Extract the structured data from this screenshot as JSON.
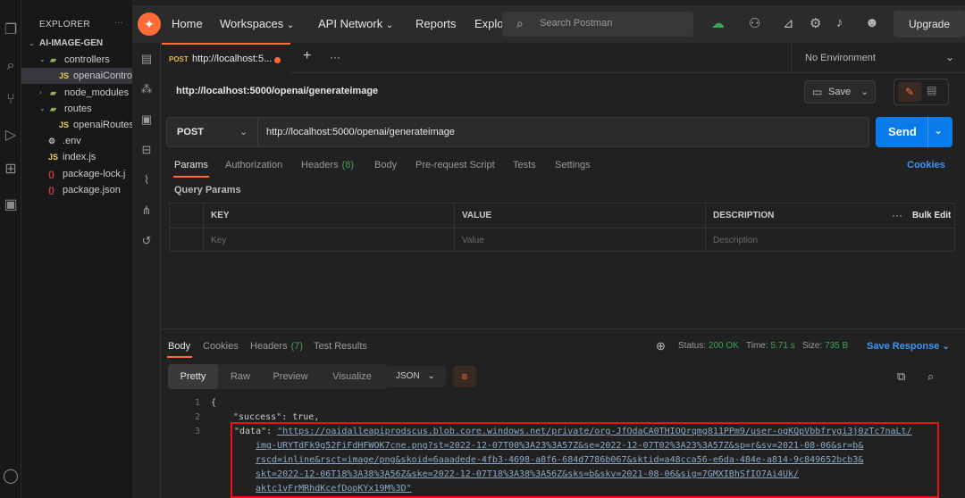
{
  "vscode": {
    "explorer_title": "EXPLORER",
    "explorer_more": "···",
    "tree": [
      {
        "label": "AI-IMAGE-GEN",
        "depth": 0,
        "kind": "root"
      },
      {
        "label": "controllers",
        "depth": 1,
        "kind": "folder"
      },
      {
        "label": "openaiControl",
        "depth": 2,
        "kind": "js",
        "selected": true
      },
      {
        "label": "node_modules",
        "depth": 1,
        "kind": "folder"
      },
      {
        "label": "routes",
        "depth": 1,
        "kind": "folder"
      },
      {
        "label": "openaiRoutes",
        "depth": 2,
        "kind": "js"
      },
      {
        "label": ".env",
        "depth": 1,
        "kind": "env"
      },
      {
        "label": "index.js",
        "depth": 1,
        "kind": "js"
      },
      {
        "label": "package-lock.j",
        "depth": 1,
        "kind": "json"
      },
      {
        "label": "package.json",
        "depth": 1,
        "kind": "json"
      }
    ]
  },
  "topbar": {
    "home": "Home",
    "workspaces": "Workspaces",
    "api_network": "API Network",
    "reports": "Reports",
    "explore": "Explo",
    "search_placeholder": "Search Postman",
    "upgrade": "Upgrade"
  },
  "tab": {
    "method": "POST",
    "url": "http://localhost:5...",
    "environment": "No Environment"
  },
  "request": {
    "title": "http://localhost:5000/openai/generateimage",
    "save_label": "Save",
    "method": "POST",
    "url": "http://localhost:5000/openai/generateimage",
    "send_label": "Send"
  },
  "request_tabs": [
    {
      "label": "Params",
      "active": true
    },
    {
      "label": "Authorization"
    },
    {
      "label": "Headers",
      "count": "(8)"
    },
    {
      "label": "Body"
    },
    {
      "label": "Pre-request Script"
    },
    {
      "label": "Tests"
    },
    {
      "label": "Settings"
    }
  ],
  "cookies": "Cookies",
  "query_params": {
    "title": "Query Params",
    "headers": [
      "KEY",
      "VALUE",
      "DESCRIPTION"
    ],
    "placeholders": [
      "Key",
      "Value",
      "Description"
    ],
    "more": "···",
    "bulk_edit": "Bulk Edit"
  },
  "response_tabs": [
    {
      "label": "Body",
      "active": true
    },
    {
      "label": "Cookies"
    },
    {
      "label": "Headers",
      "count": "(7)"
    },
    {
      "label": "Test Results"
    }
  ],
  "status": {
    "status_label": "Status:",
    "status_value": "200 OK",
    "time_label": "Time:",
    "time_value": "5.71 s",
    "size_label": "Size:",
    "size_value": "735 B",
    "save_response": "Save Response"
  },
  "format": {
    "modes": [
      "Pretty",
      "Raw",
      "Preview",
      "Visualize"
    ],
    "active": "Pretty",
    "language": "JSON"
  },
  "code": {
    "line_numbers": [
      "1",
      "2",
      "3"
    ],
    "open_brace": "{",
    "success_key": "\"success\"",
    "success_value": "true,",
    "data_key": "\"data\"",
    "url_lines": [
      "\"https://oaidalleapiprodscus.blob.core.windows.net/private/org-JfOdaCA0THIOQrqmg811PPm9/user-ogKQpVbbfrygi3j0zTc7naLt/",
      "img-URYTdFk9g52FiFdHFWOK7cne.png?st=2022-12-07T00%3A23%3A57Z&se=2022-12-07T02%3A23%3A57Z&sp=r&sv=2021-08-06&sr=b&",
      "rscd=inline&rsct=image/png&skoid=6aaadede-4fb3-4698-a8f6-684d7786b067&sktid=a48cca56-e6da-484e-a814-9c849652bcb3&",
      "skt=2022-12-06T18%3A38%3A56Z&ske=2022-12-07T18%3A38%3A56Z&sks=b&skv=2021-08-06&sig=7GMXIBhSfIO7Ai4Uk/",
      "aktc1vFrMRhdKcefDopKYx19M%3D\""
    ]
  },
  "colors": {
    "accent": "#ff6c37",
    "send_button": "#097bed",
    "link": "#3d96f5",
    "ok": "#3ca452",
    "highlight_box": "#ee1111"
  }
}
